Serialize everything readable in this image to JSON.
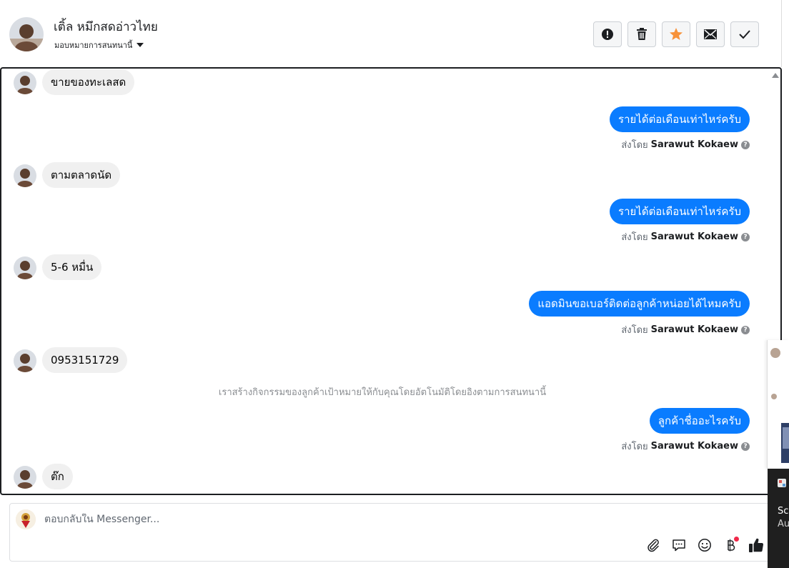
{
  "header": {
    "contact_name": "เติ้ล หมึกสดอ่าวไทย",
    "assign_label": "มอบหมายการสนทนานี้",
    "actions": [
      {
        "icon": "alert-icon",
        "label": ""
      },
      {
        "icon": "trash-icon",
        "label": ""
      },
      {
        "icon": "star-icon",
        "label": ""
      },
      {
        "icon": "envelope-icon",
        "label": ""
      },
      {
        "icon": "check-icon",
        "label": ""
      }
    ],
    "star_color": "#f7923a"
  },
  "messages": [
    {
      "direction": "in",
      "text": "ขายของทะเลสด"
    },
    {
      "direction": "out",
      "text": "รายได้ต่อเดือนเท่าไหร่ครับ",
      "sent_by_prefix": "ส่งโดย",
      "sender": "Sarawut Kokaew"
    },
    {
      "direction": "in",
      "text": "ตามตลาดนัด"
    },
    {
      "direction": "out",
      "text": "รายได้ต่อเดือนเท่าไหร่ครับ",
      "sent_by_prefix": "ส่งโดย",
      "sender": "Sarawut Kokaew"
    },
    {
      "direction": "in",
      "text": "5-6 หมื่น"
    },
    {
      "direction": "out",
      "text": "แอดมินขอเบอร์ติดต่อลูกค้าหน่อยได้ไหมครับ",
      "sent_by_prefix": "ส่งโดย",
      "sender": "Sarawut Kokaew"
    },
    {
      "direction": "in",
      "text": "0953151729"
    },
    {
      "direction": "system",
      "text": "เราสร้างกิจกรรมของลูกค้าเป้าหมายให้กับคุณโดยอัตโนมัติโดยอิงตามการสนทนานี้"
    },
    {
      "direction": "out",
      "text": "ลูกค้าชื่ออะไรครับ",
      "sent_by_prefix": "ส่งโดย",
      "sender": "Sarawut Kokaew"
    },
    {
      "direction": "in",
      "text": "ต๊ก"
    }
  ],
  "reply": {
    "placeholder": "ตอบกลับใน Messenger...",
    "tools": [
      "paperclip-icon",
      "quick-reply-icon",
      "emoji-icon",
      "payment-icon",
      "thumbs-up-icon"
    ]
  },
  "colors": {
    "outgoing_bubble": "#0a7cff",
    "incoming_bubble": "#f0f0f0",
    "like_icon": "#1c1e21"
  },
  "overlay": {
    "line1": "Sc",
    "line2": "Au"
  }
}
